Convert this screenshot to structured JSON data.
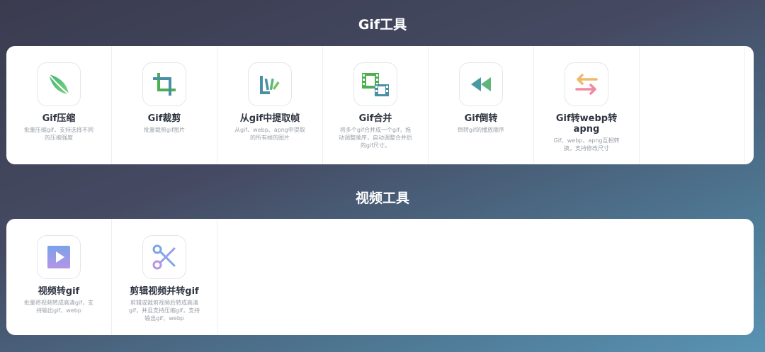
{
  "sections": [
    {
      "title": "Gif工具",
      "cards": [
        {
          "title": "Gif压缩",
          "desc": "批量压缩gif，支持选择不同的压缩强度",
          "icon": "leaf-icon"
        },
        {
          "title": "Gif裁剪",
          "desc": "批量裁剪gif图片",
          "icon": "crop-icon"
        },
        {
          "title": "从gif中提取帧",
          "desc": "从gif、webp、apng中提取的所有帧的图片",
          "icon": "extract-frames-icon"
        },
        {
          "title": "Gif合并",
          "desc": "将多个gif合并成一个gif，拖动调整顺序，自动调整合并后的gif尺寸。",
          "icon": "film-merge-icon"
        },
        {
          "title": "Gif倒转",
          "desc": "倒转gif的播放顺序",
          "icon": "rewind-icon"
        },
        {
          "title": "Gif转webp转apng",
          "desc": "Gif、webp、apng互相转换，支持修改尺寸",
          "icon": "convert-arrows-icon"
        }
      ]
    },
    {
      "title": "视频工具",
      "cards": [
        {
          "title": "视频转gif",
          "desc": "批量将视频转成高清gif，支持输出gif、webp",
          "icon": "video-play-icon"
        },
        {
          "title": "剪辑视频并转gif",
          "desc": "剪辑或裁剪视频后转成高清gif，并且支持压缩gif，支持输出gif、webp",
          "icon": "scissors-icon"
        }
      ]
    }
  ]
}
